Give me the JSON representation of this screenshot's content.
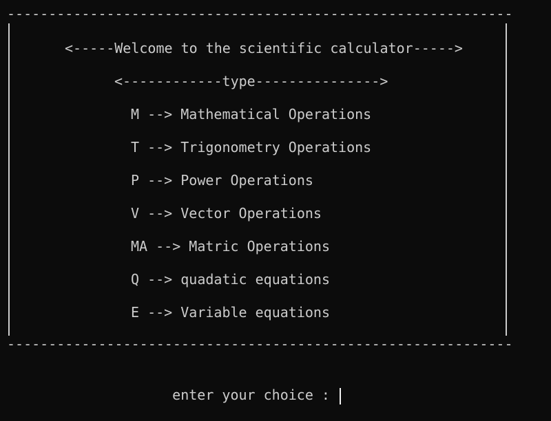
{
  "border": {
    "top_rule": "--------------------------------------------------------------------------------------------",
    "bottom_rule": "--------------------------------------------------------------------------------------------"
  },
  "header": {
    "welcome": "<-----Welcome to the scientific calculator----->",
    "type_heading": "<------------type--------------->"
  },
  "menu": {
    "items": [
      {
        "key": "M",
        "label": "M --> Mathematical Operations"
      },
      {
        "key": "T",
        "label": "T --> Trigonometry Operations"
      },
      {
        "key": "P",
        "label": "P --> Power Operations"
      },
      {
        "key": "V",
        "label": "V --> Vector Operations"
      },
      {
        "key": "MA",
        "label": "MA --> Matric Operations"
      },
      {
        "key": "Q",
        "label": "Q --> quadatic equations"
      },
      {
        "key": "E",
        "label": "E --> Variable equations"
      }
    ]
  },
  "prompt": {
    "text": "enter your choice : ",
    "input_value": ""
  },
  "colors": {
    "background": "#0c0c0c",
    "text": "#cccccc",
    "cursor": "#f2f2f2"
  }
}
